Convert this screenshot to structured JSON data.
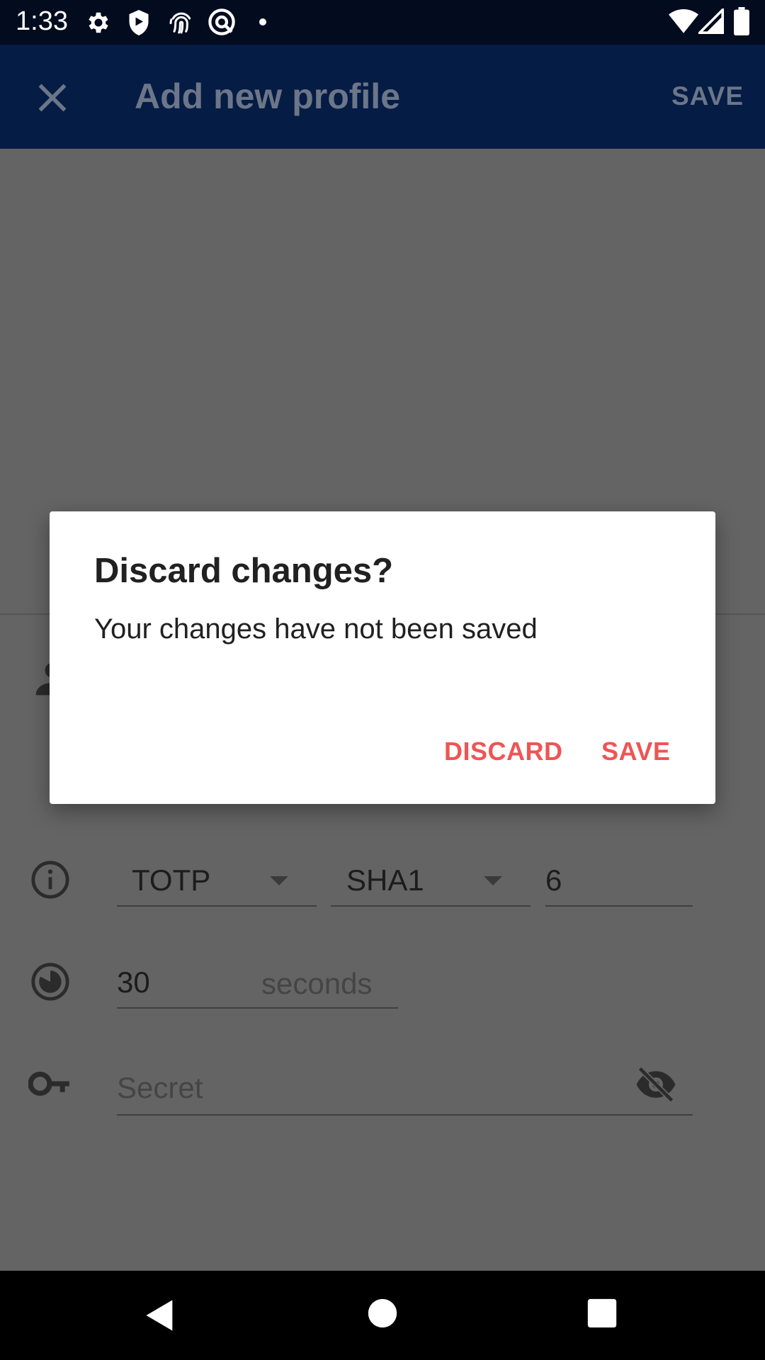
{
  "status_bar": {
    "time": "1:33"
  },
  "app_bar": {
    "title": "Add new profile",
    "save_label": "SAVE"
  },
  "form": {
    "type_value": "TOTP",
    "algorithm_value": "SHA1",
    "digits_value": "6",
    "period_value": "30",
    "period_suffix": "seconds",
    "secret_placeholder": "Secret"
  },
  "dialog": {
    "title": "Discard changes?",
    "message": "Your changes have not been saved",
    "discard_label": "DISCARD",
    "save_label": "SAVE"
  },
  "colors": {
    "status_bar_bg": "#030b1f",
    "app_bar_bg": "#051c44",
    "scrim_bg": "#646464",
    "dialog_action": "#f05454"
  },
  "icons": {
    "status": [
      "gear-icon",
      "shield-icon",
      "fingerprint-icon",
      "at-sign-icon",
      "dot-icon",
      "wifi-icon",
      "signal-icon",
      "battery-icon"
    ],
    "app_bar": [
      "close-icon"
    ],
    "form": [
      "person-icon",
      "info-icon",
      "timer-icon",
      "key-icon",
      "visibility-off-icon"
    ],
    "nav": [
      "back-icon",
      "home-icon",
      "recents-icon"
    ]
  }
}
